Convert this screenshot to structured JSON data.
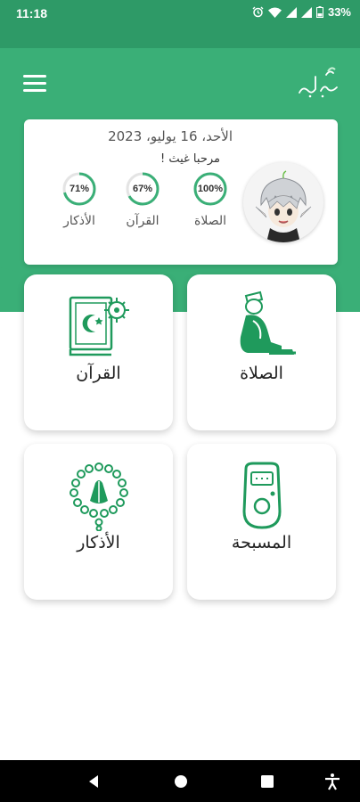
{
  "status": {
    "time": "11:18",
    "battery": "33%"
  },
  "header": {
    "logo_text": "إشراقة"
  },
  "summary": {
    "date": "الأحد، 16 يوليو، 2023",
    "greeting": "مرحبا غيث !",
    "stats": [
      {
        "label": "الصلاة",
        "percent_text": "100%",
        "percent": 100
      },
      {
        "label": "القرآن",
        "percent_text": "67%",
        "percent": 67
      },
      {
        "label": "الأذكار",
        "percent_text": "71%",
        "percent": 71
      }
    ]
  },
  "tiles": [
    {
      "label": "الصلاة",
      "icon": "prayer-icon"
    },
    {
      "label": "القرآن",
      "icon": "quran-icon"
    },
    {
      "label": "المسبحة",
      "icon": "tasbih-counter-icon"
    },
    {
      "label": "الأذكار",
      "icon": "prayer-beads-icon"
    }
  ],
  "colors": {
    "primary": "#3aaf77",
    "primary_dark": "#2e9a67",
    "icon_green": "#1f9a5c"
  }
}
